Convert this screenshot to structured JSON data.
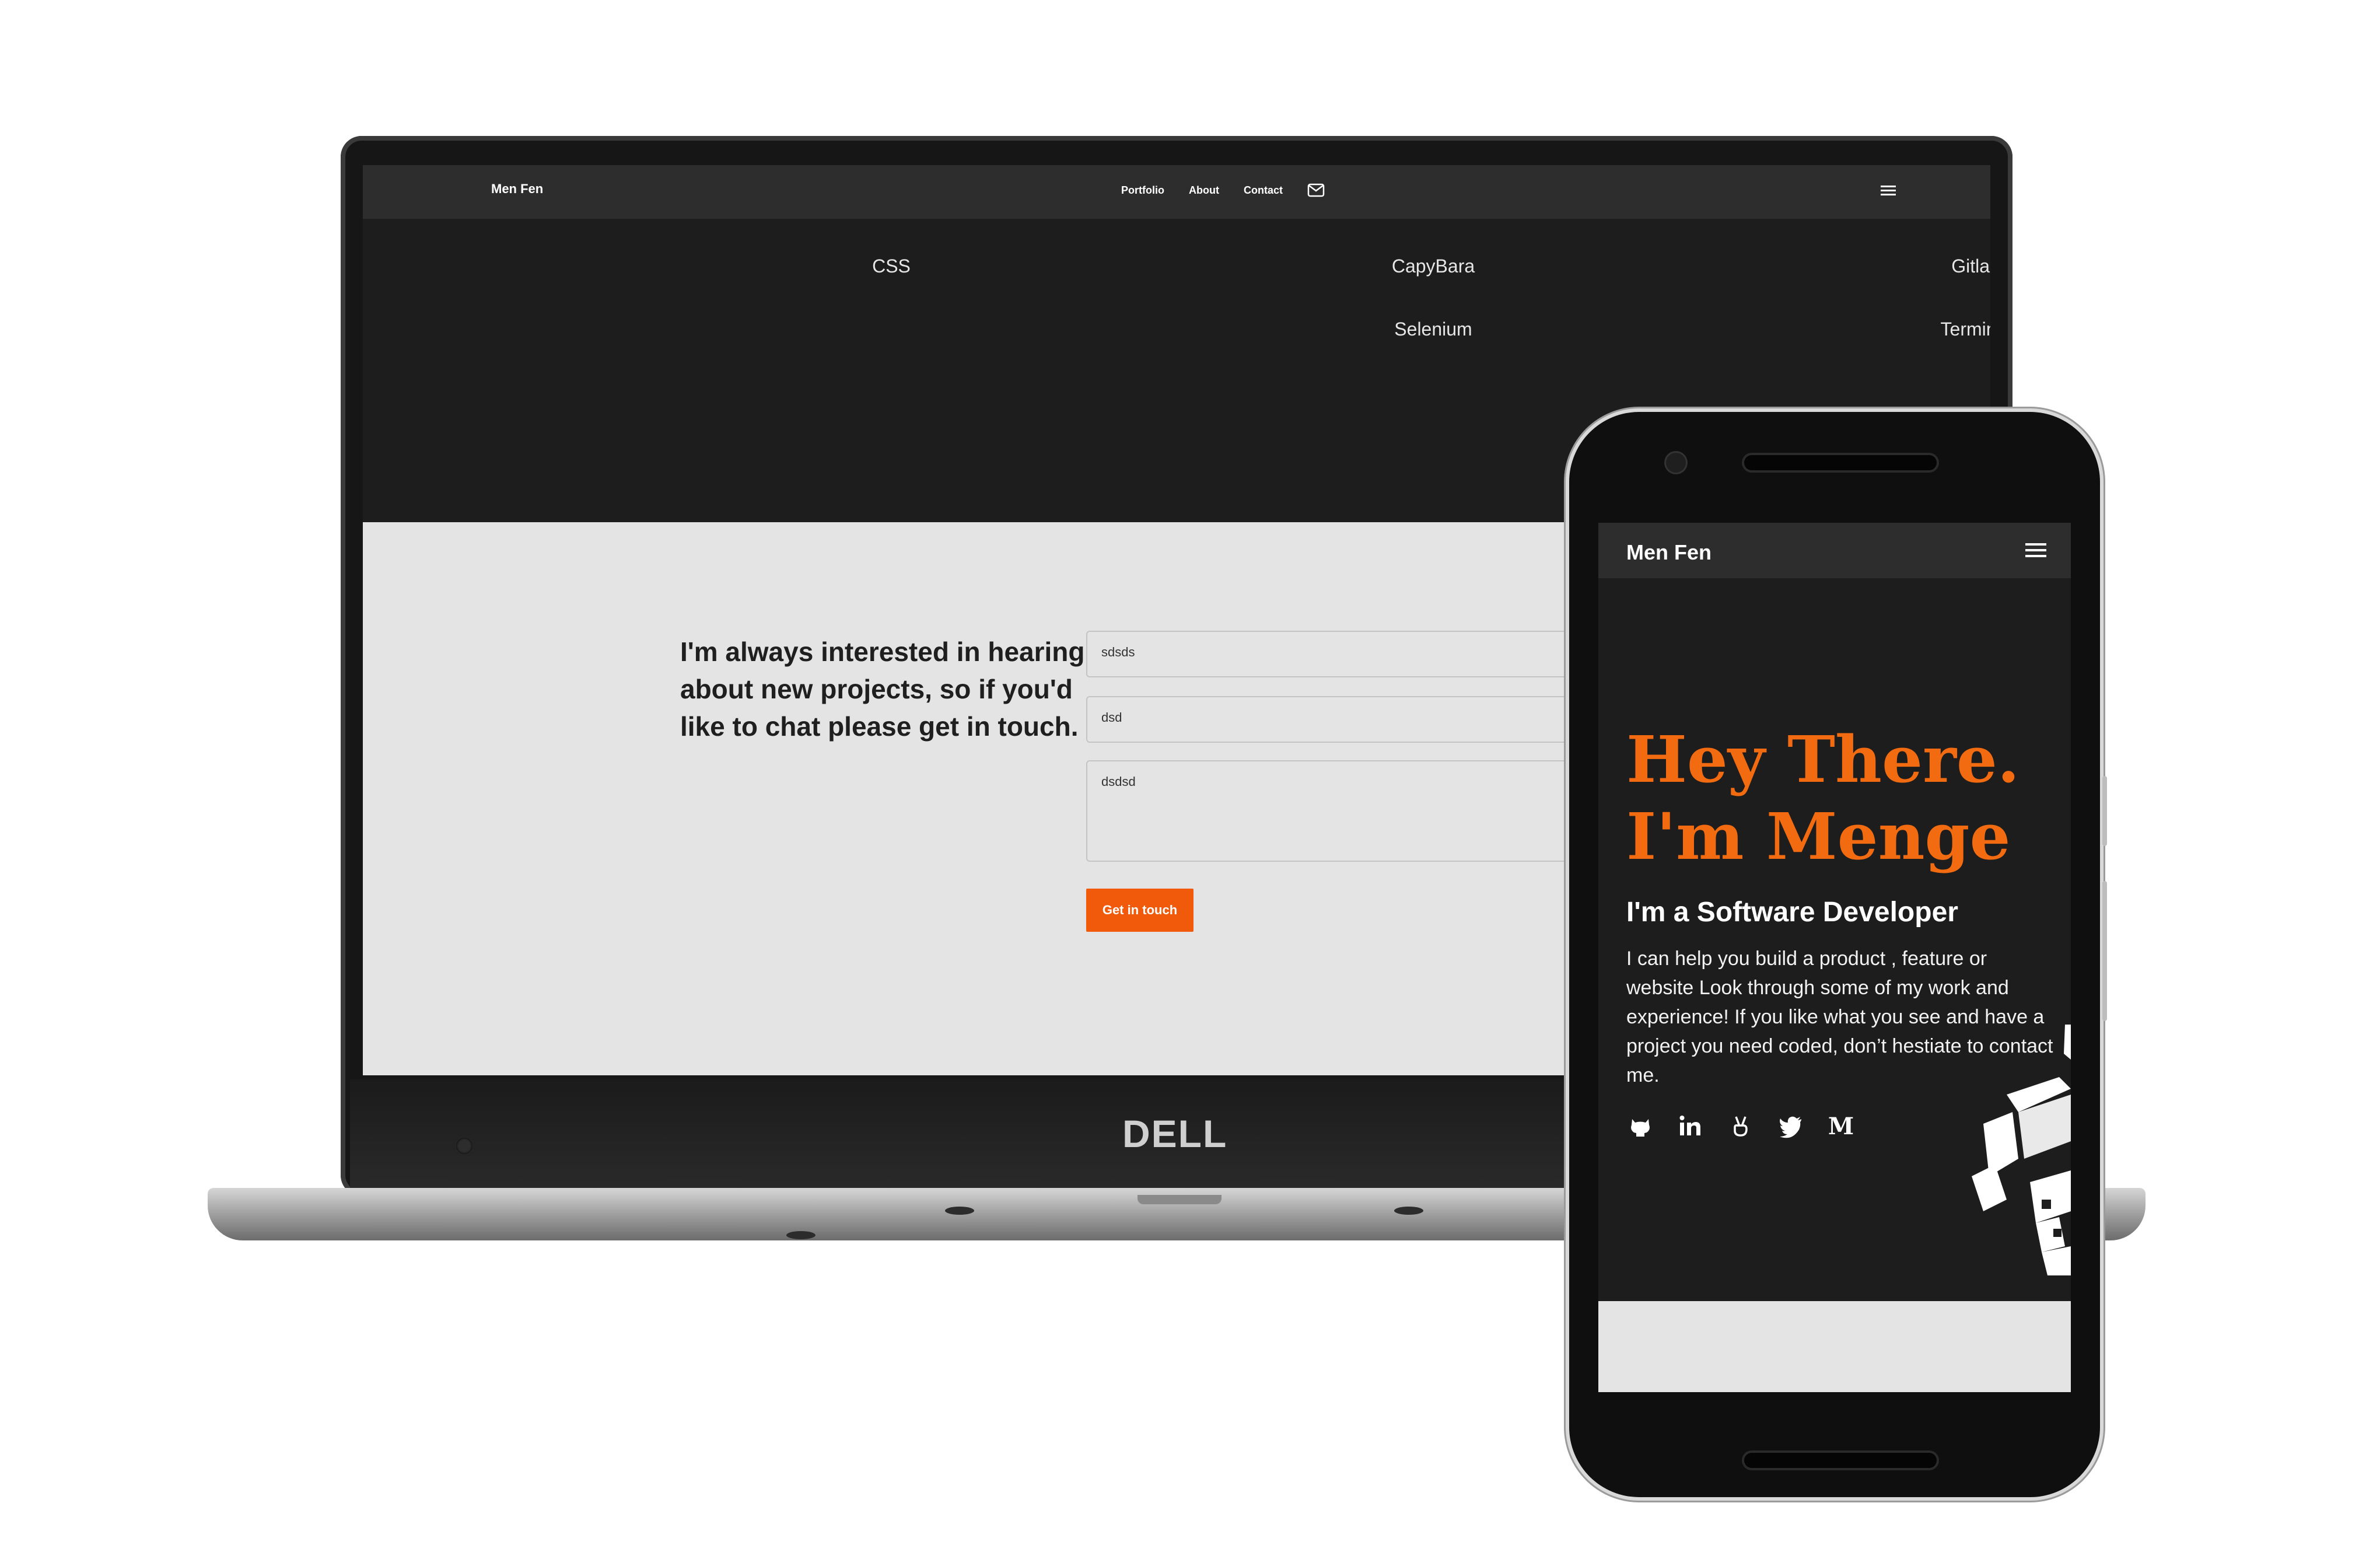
{
  "laptop": {
    "brand": "DELL",
    "nav": {
      "brand": "Men Fen",
      "links": [
        "Portfolio",
        "About",
        "Contact"
      ],
      "mail_icon": "mail-icon",
      "menu_icon": "hamburger-icon"
    },
    "skills": {
      "row1": [
        "CSS",
        "CapyBara",
        "Gitlab"
      ],
      "row2": [
        "Selenium",
        "Terminal"
      ]
    },
    "contact": {
      "pitch": "I'm always interested in hearing about new projects, so if you'd like to chat please get in touch.",
      "name_value": "sdsds",
      "email_value": "dsd",
      "message_value": "dsdsd",
      "button_label": "Get in touch",
      "accent_color": "#f05a0a"
    }
  },
  "phone": {
    "nav": {
      "brand": "Men Fen",
      "menu_icon": "hamburger-icon"
    },
    "hero": {
      "line1": "Hey There.",
      "line2": "I'm Menge",
      "subtitle": "I'm a Software Developer",
      "description": "I can help you build a product , feature or website Look through some of my work and experience! If you like what you see and have a project you need coded, don’t hestiate to contact me.",
      "accent_color": "#f26b10"
    },
    "socials": [
      "github-icon",
      "linkedin-icon",
      "angellist-icon",
      "twitter-icon",
      "medium-icon"
    ],
    "medium_letter": "M"
  }
}
